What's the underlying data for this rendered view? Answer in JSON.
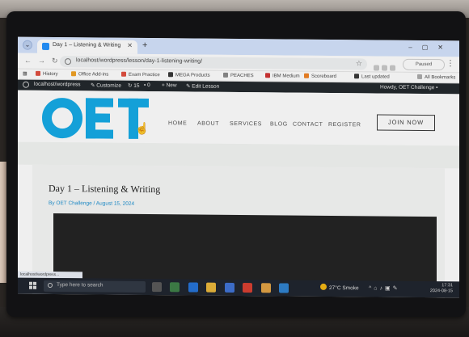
{
  "browser": {
    "tab_title": "Day 1 – Listening & Writing",
    "new_tab": "+",
    "url": "localhost/wordpress/lesson/day-1-listening-writing/",
    "profile_label": "Paused",
    "bookmarks": [
      "History",
      "Office Add-ins",
      "Exam Practice",
      "MEGA Products",
      "PEACHES",
      "IBM Medium",
      "Scoreboard",
      "Last updated",
      "All Bookmarks"
    ]
  },
  "wp_admin": {
    "site": "localhost/wordpress",
    "customize": "Customize",
    "updates": "15",
    "comments": "0",
    "new": "New",
    "edit": "Edit Lesson",
    "greeting": "Howdy, OET Challenge"
  },
  "site": {
    "logo_text": "OET",
    "brand_color": "#0fa8e6",
    "nav": [
      "HOME",
      "ABOUT",
      "SERVICES",
      "BLOG",
      "CONTACT",
      "REGISTER"
    ],
    "cta": "JOIN NOW"
  },
  "post": {
    "title": "Day 1 – Listening & Writing",
    "meta": "By OET Challenge / August 15, 2024"
  },
  "taskbar": {
    "search_placeholder": "Type here to search",
    "weather": "27°C Smoke",
    "time": "17:31",
    "date": "2024-08-15"
  },
  "status_bar_url": "localhost/wordpress..."
}
